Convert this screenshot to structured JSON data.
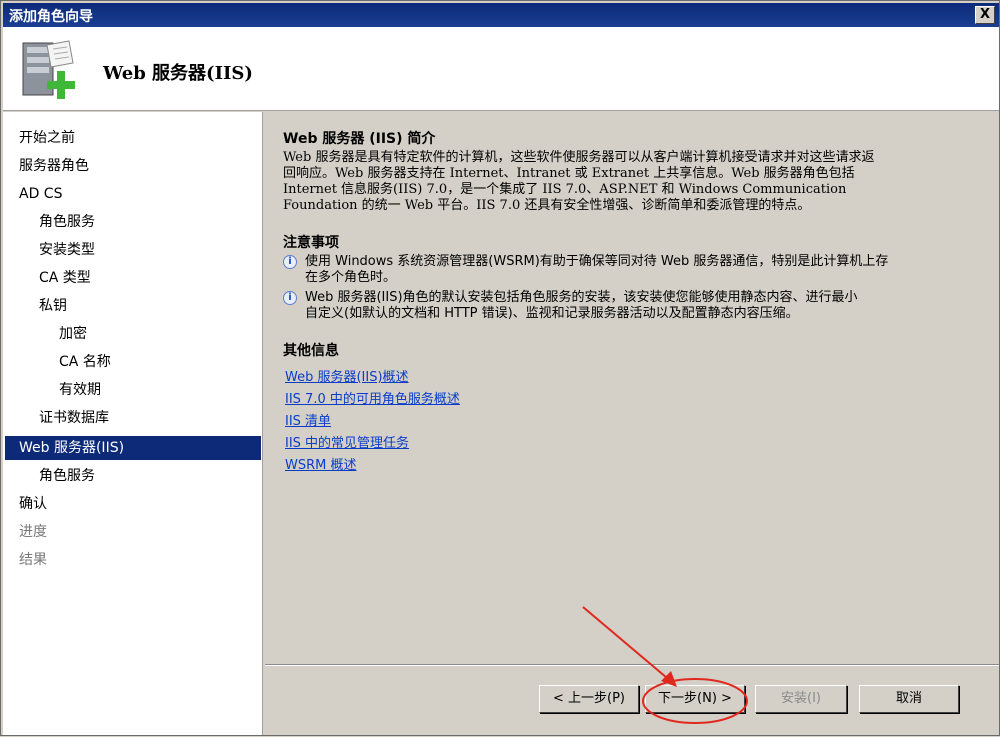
{
  "window": {
    "title": "添加角色向导",
    "close_label": "X"
  },
  "header": {
    "title": "Web 服务器(IIS)"
  },
  "sidebar": {
    "items": [
      {
        "label": "开始之前"
      },
      {
        "label": "服务器角色"
      },
      {
        "label": "AD CS"
      },
      {
        "label": "角色服务"
      },
      {
        "label": "安装类型"
      },
      {
        "label": "CA 类型"
      },
      {
        "label": "私钥"
      },
      {
        "label": "加密"
      },
      {
        "label": "CA 名称"
      },
      {
        "label": "有效期"
      },
      {
        "label": "证书数据库"
      },
      {
        "label": "Web 服务器(IIS)"
      },
      {
        "label": "角色服务"
      },
      {
        "label": "确认"
      },
      {
        "label": "进度"
      },
      {
        "label": "结果"
      }
    ]
  },
  "content": {
    "intro_title": "Web 服务器 (IIS) 简介",
    "intro_lines": [
      "Web 服务器是具有特定软件的计算机，这些软件使服务器可以从客户端计算机接受请求并对这些请求返",
      "回响应。Web 服务器支持在 Internet、Intranet 或 Extranet 上共享信息。Web 服务器角色包括",
      "Internet 信息服务(IIS) 7.0，是一个集成了 IIS 7.0、ASP.NET 和 Windows Communication",
      "Foundation 的统一 Web 平台。IIS 7.0 还具有安全性增强、诊断简单和委派管理的特点。"
    ],
    "notes_title": "注意事项",
    "notes": [
      {
        "line1": "使用 Windows 系统资源管理器(WSRM)有助于确保等同对待 Web 服务器通信，特别是此计算机上存",
        "line2": "在多个角色时。"
      },
      {
        "line1": "Web 服务器(IIS)角色的默认安装包括角色服务的安装，该安装使您能够使用静态内容、进行最小",
        "line2": "自定义(如默认的文档和 HTTP 错误)、监视和记录服务器活动以及配置静态内容压缩。"
      }
    ],
    "more_title": "其他信息",
    "links": [
      "Web 服务器(IIS)概述",
      "IIS 7.0 中的可用角色服务概述",
      "IIS 清单",
      "IIS 中的常见管理任务",
      "WSRM 概述"
    ]
  },
  "buttons": {
    "back": "< 上一步(P)",
    "next": "下一步(N) >",
    "install": "安装(I)",
    "cancel": "取消"
  },
  "colors": {
    "selection": "#0c2a78",
    "link": "#0a3cc8",
    "annotation": "#e0281e"
  }
}
